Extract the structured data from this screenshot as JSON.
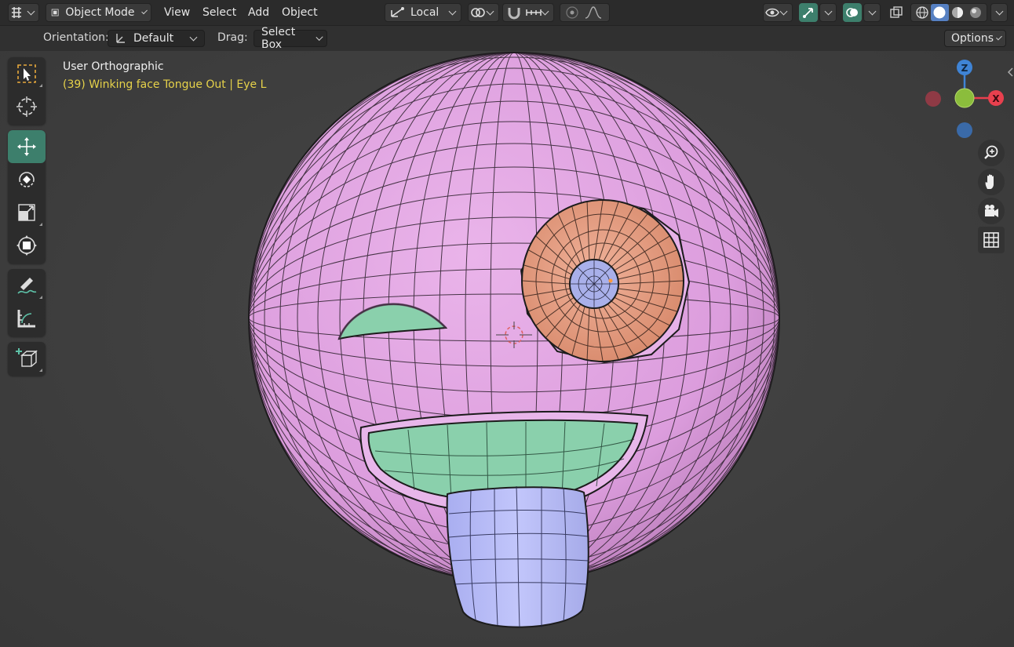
{
  "header": {
    "mode_label": "Object Mode",
    "menus": [
      "View",
      "Select",
      "Add",
      "Object"
    ],
    "transform_orientation": "Local"
  },
  "tool_settings": {
    "orientation_label": "Orientation:",
    "orientation_value": "Default",
    "drag_label": "Drag:",
    "drag_value": "Select Box",
    "options_label": "Options"
  },
  "viewport": {
    "view_name": "User Orthographic",
    "object_info": "(39) Winking face Tongue Out | Eye L",
    "object_info_color": "#e6d24a"
  },
  "gizmo": {
    "z_label": "Z",
    "x_label": "X",
    "z_color": "#3f84d6",
    "x_color": "#e8404e",
    "y_color": "#8bbd3c"
  },
  "model": {
    "face_color": "#e0a4e0",
    "eye_color": "#e79f80",
    "pupil_color": "#a9b0ea",
    "mouth_color": "#8ad0ac",
    "tongue_color": "#b8bdf6"
  },
  "colors": {
    "accent": "#3d7f6c",
    "header_bg": "#2b2b2b",
    "viewport_bg": "#3d3d3d"
  },
  "tools": [
    "select-box",
    "cursor",
    "move",
    "rotate",
    "scale",
    "transform",
    "annotate",
    "measure",
    "add-cube"
  ]
}
